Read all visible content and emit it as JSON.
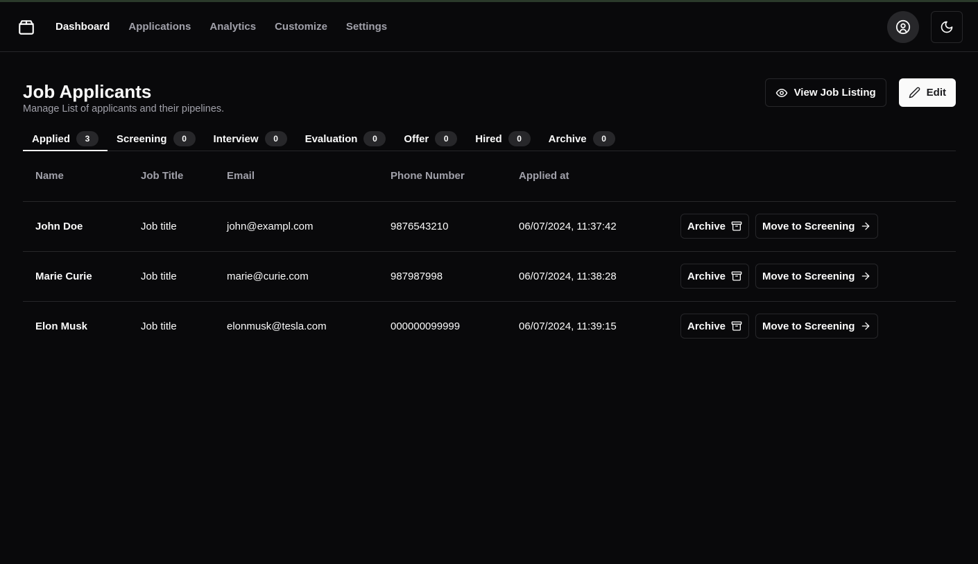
{
  "nav": {
    "items": [
      {
        "label": "Dashboard",
        "active": true
      },
      {
        "label": "Applications",
        "active": false
      },
      {
        "label": "Analytics",
        "active": false
      },
      {
        "label": "Customize",
        "active": false
      },
      {
        "label": "Settings",
        "active": false
      }
    ]
  },
  "page": {
    "title": "Job Applicants",
    "subtitle": "Manage List of applicants and their pipelines.",
    "view_listing_label": "View Job Listing",
    "edit_label": "Edit"
  },
  "tabs": [
    {
      "label": "Applied",
      "count": "3",
      "active": true
    },
    {
      "label": "Screening",
      "count": "0",
      "active": false
    },
    {
      "label": "Interview",
      "count": "0",
      "active": false
    },
    {
      "label": "Evaluation",
      "count": "0",
      "active": false
    },
    {
      "label": "Offer",
      "count": "0",
      "active": false
    },
    {
      "label": "Hired",
      "count": "0",
      "active": false
    },
    {
      "label": "Archive",
      "count": "0",
      "active": false
    }
  ],
  "table": {
    "columns": [
      "Name",
      "Job Title",
      "Email",
      "Phone Number",
      "Applied at"
    ],
    "archive_label": "Archive",
    "move_label": "Move to Screening",
    "rows": [
      {
        "name": "John Doe",
        "job_title": "Job title",
        "email": "john@exampl.com",
        "phone": "9876543210",
        "applied_at": "06/07/2024, 11:37:42"
      },
      {
        "name": "Marie Curie",
        "job_title": "Job title",
        "email": "marie@curie.com",
        "phone": "987987998",
        "applied_at": "06/07/2024, 11:38:28"
      },
      {
        "name": "Elon Musk",
        "job_title": "Job title",
        "email": "elonmusk@tesla.com",
        "phone": "000000099999",
        "applied_at": "06/07/2024, 11:39:15"
      }
    ]
  },
  "icons": {
    "logo": "package-icon",
    "user": "user-circle-icon",
    "theme": "moon-icon",
    "view": "eye-icon",
    "edit": "pencil-icon",
    "archive": "archive-icon",
    "move": "arrow-right-icon"
  },
  "colors": {
    "background": "#09090b",
    "border": "#27272a",
    "muted_text": "#a1a1aa",
    "foreground": "#fafafa"
  }
}
